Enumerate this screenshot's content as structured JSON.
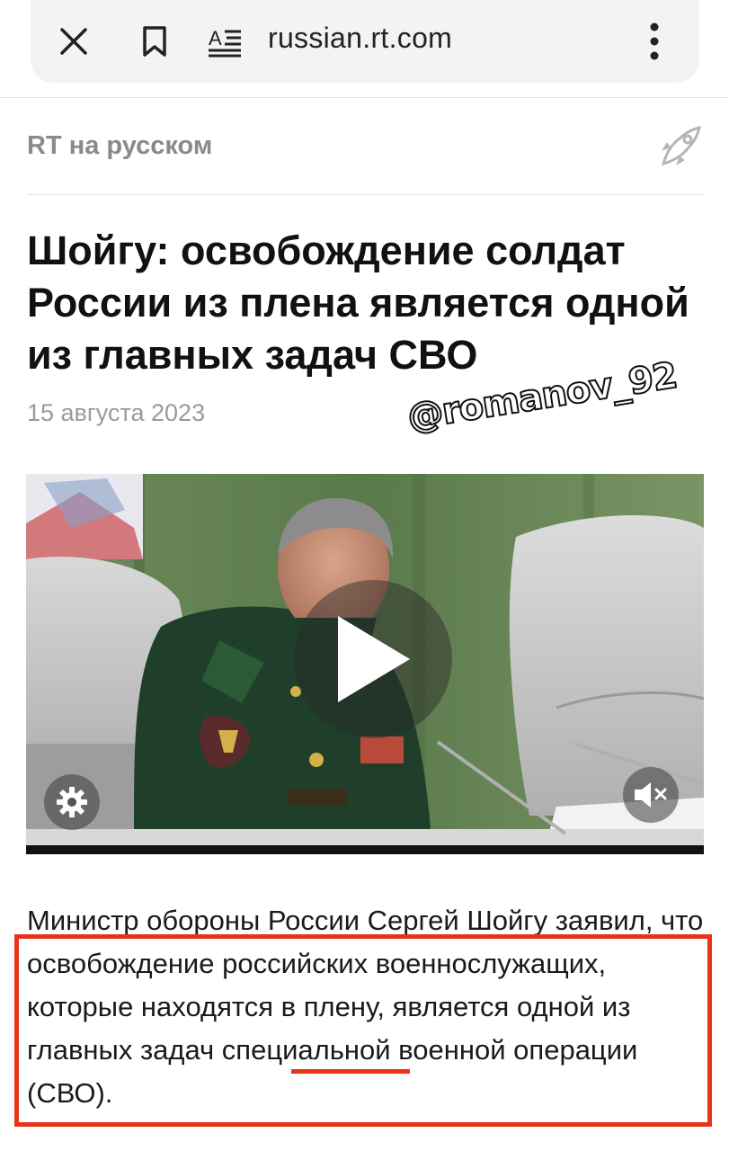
{
  "browser": {
    "url": "russian.rt.com",
    "close_icon": "close-icon",
    "bookmark_icon": "bookmark-icon",
    "reader_icon": "reader-mode-icon",
    "menu_icon": "more-vert-icon"
  },
  "site": {
    "name": "RT на русском",
    "logo_icon": "rocket-icon"
  },
  "article": {
    "headline": "Шойгу: освобождение солдат России из плена является одной из главных задач СВО",
    "date": "15 августа 2023",
    "watermark": "@romanov_92",
    "video": {
      "play_icon": "play-icon",
      "settings_icon": "gear-icon",
      "mute_icon": "mute-icon"
    },
    "body": "Министр обороны России Сергей Шойгу заявил, что освобождение российских военнослужащих, которые находятся в плену, является одной из главных задач специальной военной операции (СВО)."
  },
  "colors": {
    "highlight": "#e8321c",
    "site_name": "#8a8a8a",
    "date": "#9a9a9a"
  }
}
